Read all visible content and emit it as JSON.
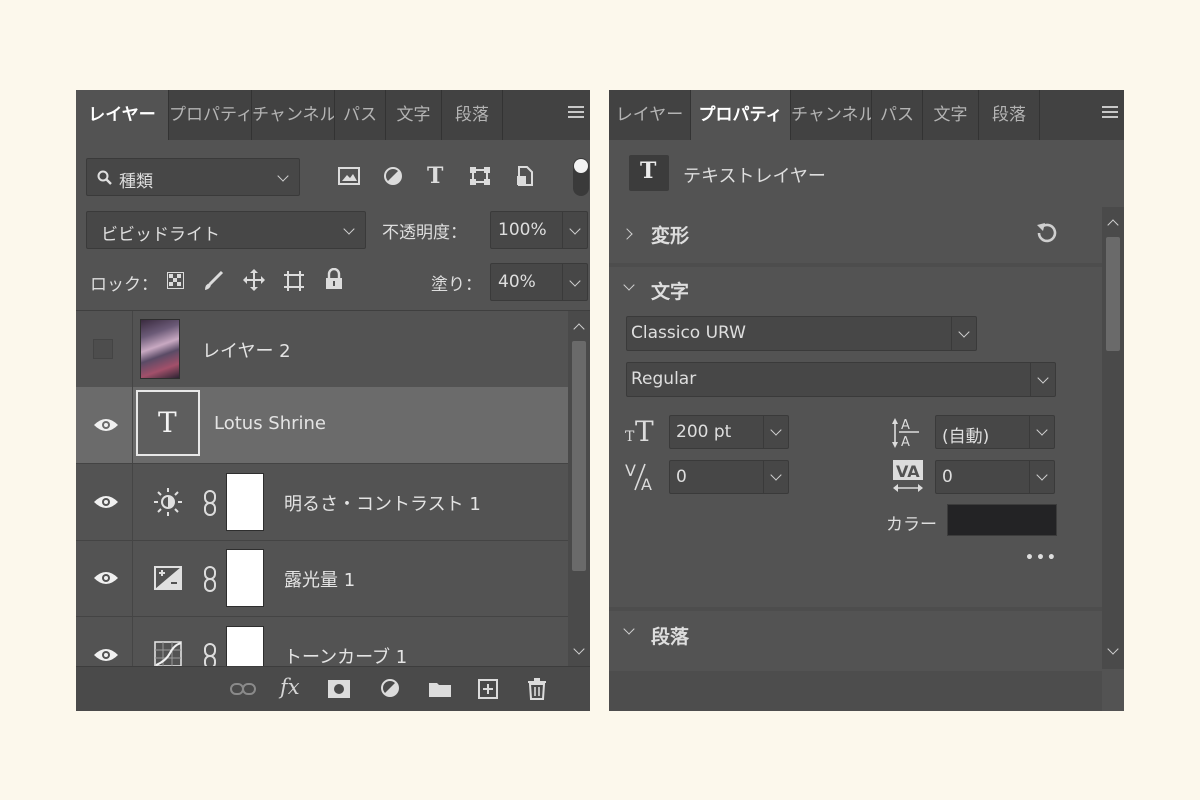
{
  "layers_panel": {
    "tabs": [
      "レイヤー",
      "プロパティ",
      "チャンネル",
      "パス",
      "文字",
      "段落"
    ],
    "filter": {
      "label": "種類"
    },
    "blend_mode": "ビビッドライト",
    "opacity": {
      "label": "不透明度：",
      "value": "100%"
    },
    "lock": {
      "label": "ロック："
    },
    "fill": {
      "label": "塗り：",
      "value": "40%"
    },
    "layers": [
      {
        "name": "レイヤー 2",
        "type": "image",
        "visible": false
      },
      {
        "name": "Lotus Shrine",
        "type": "text",
        "visible": true,
        "selected": true,
        "thumb_text": "T"
      },
      {
        "name": "明るさ・コントラスト 1",
        "type": "adjustment",
        "visible": true
      },
      {
        "name": "露光量 1",
        "type": "adjustment",
        "visible": true
      },
      {
        "name": "トーンカーブ 1",
        "type": "adjustment",
        "visible": true
      }
    ]
  },
  "props_panel": {
    "tabs": [
      "レイヤー",
      "プロパティ",
      "チャンネル",
      "パス",
      "文字",
      "段落"
    ],
    "layer_kind": {
      "icon_text": "T",
      "label": "テキストレイヤー"
    },
    "sections": {
      "transform": "変形",
      "character": "文字",
      "paragraph": "段落"
    },
    "font_family": "Classico URW",
    "font_style": "Regular",
    "font_size": "200 pt",
    "leading": "(自動)",
    "kerning": "0",
    "tracking": "0",
    "color": {
      "label": "カラー",
      "swatch": "#232325"
    },
    "more": "•••"
  },
  "colors": {
    "selected_row": "#6b6b6b",
    "panel_bg": "#535353",
    "tab_bg": "#424242"
  }
}
